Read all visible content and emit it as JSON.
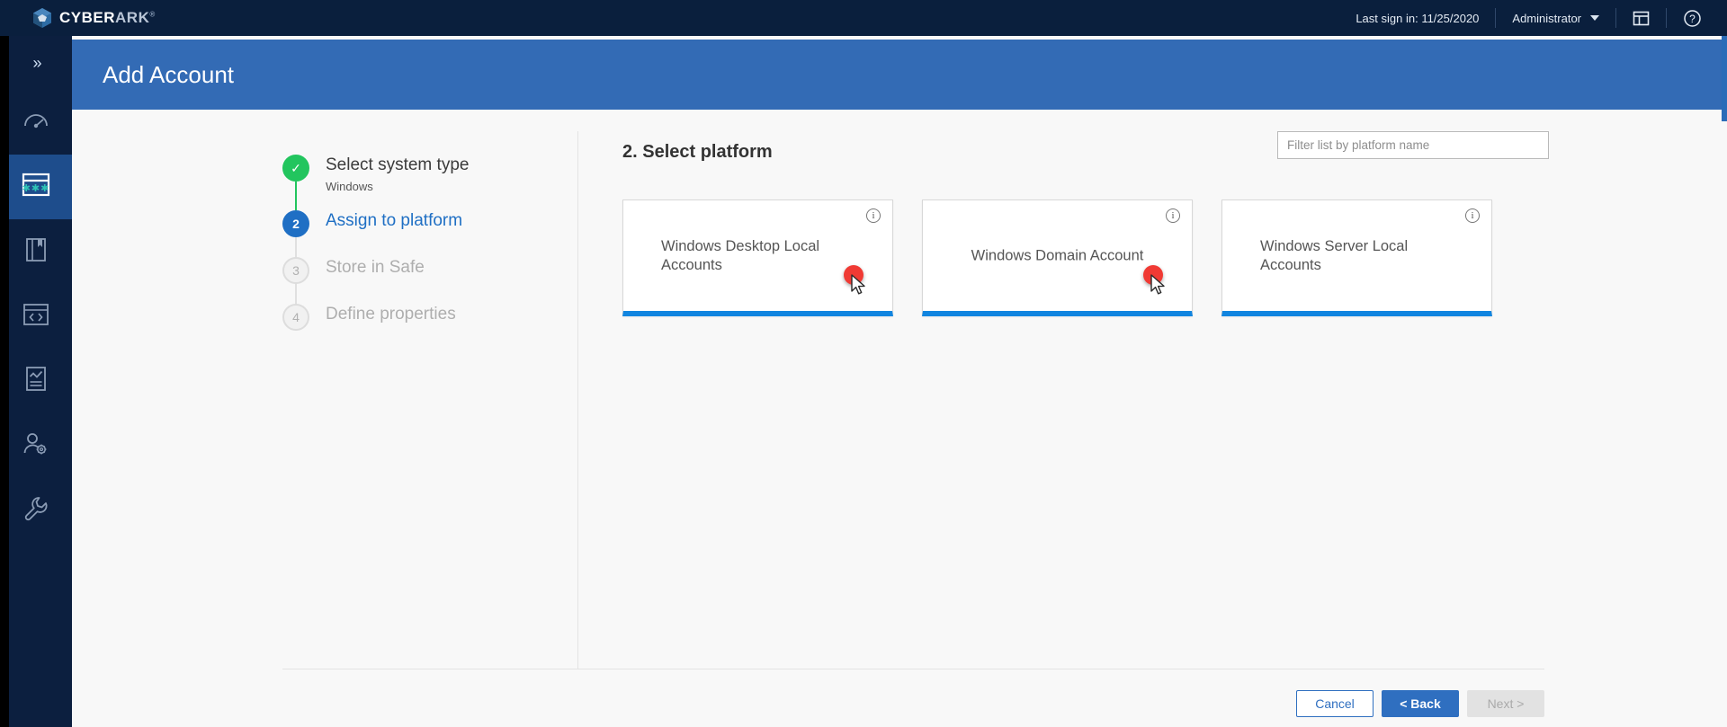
{
  "topbar": {
    "brand": {
      "primary": "CYBER",
      "secondary": "ARK",
      "trademark": "®"
    },
    "last_sign_in": "Last sign in: 11/25/2020",
    "user": "Administrator",
    "icons": {
      "layout": "layout-panels-icon",
      "help": "help-question-icon",
      "caret": "chevron-down-icon"
    }
  },
  "sidebar": {
    "collapse_glyph": "»",
    "items": [
      {
        "name": "dashboard-gauge",
        "label": "Dashboard",
        "active": false
      },
      {
        "name": "accounts-password-window",
        "label": "Accounts",
        "active": true
      },
      {
        "name": "policies-book",
        "label": "Policies",
        "active": false
      },
      {
        "name": "applications-code-window",
        "label": "Applications",
        "active": false
      },
      {
        "name": "reports-chart-document",
        "label": "Reports",
        "active": false
      },
      {
        "name": "user-management-gear",
        "label": "User Management",
        "active": false
      },
      {
        "name": "administration-wrench",
        "label": "Administration",
        "active": false
      }
    ]
  },
  "page": {
    "title": "Add Account"
  },
  "stepper": {
    "steps": [
      {
        "number": "1",
        "glyph": "✓",
        "title": "Select system type",
        "subtitle": "Windows",
        "state": "done"
      },
      {
        "number": "2",
        "glyph": "2",
        "title": "Assign to platform",
        "subtitle": "",
        "state": "current"
      },
      {
        "number": "3",
        "glyph": "3",
        "title": "Store in Safe",
        "subtitle": "",
        "state": "todo"
      },
      {
        "number": "4",
        "glyph": "4",
        "title": "Define properties",
        "subtitle": "",
        "state": "todo"
      }
    ]
  },
  "content": {
    "section_title": "2. Select platform",
    "filter": {
      "value": "",
      "placeholder": "Filter list by platform name"
    },
    "platforms": [
      {
        "name": "Windows Desktop Local Accounts",
        "align": "left",
        "info": "ⓘ"
      },
      {
        "name": "Windows Domain Account",
        "align": "center",
        "info": "ⓘ"
      },
      {
        "name": "Windows Server Local Accounts",
        "align": "left",
        "info": "ⓘ"
      }
    ]
  },
  "footer": {
    "cancel": "Cancel",
    "back": "< Back",
    "next": "Next >"
  },
  "colors": {
    "nav_dark": "#0a1f3d",
    "header_blue": "#336bb5",
    "accent_teal": "#2ec4b6",
    "card_underline": "#1185e0",
    "step_done_green": "#22c55e",
    "step_current_blue": "#1f6fc4",
    "marker_red": "#f03a34"
  }
}
